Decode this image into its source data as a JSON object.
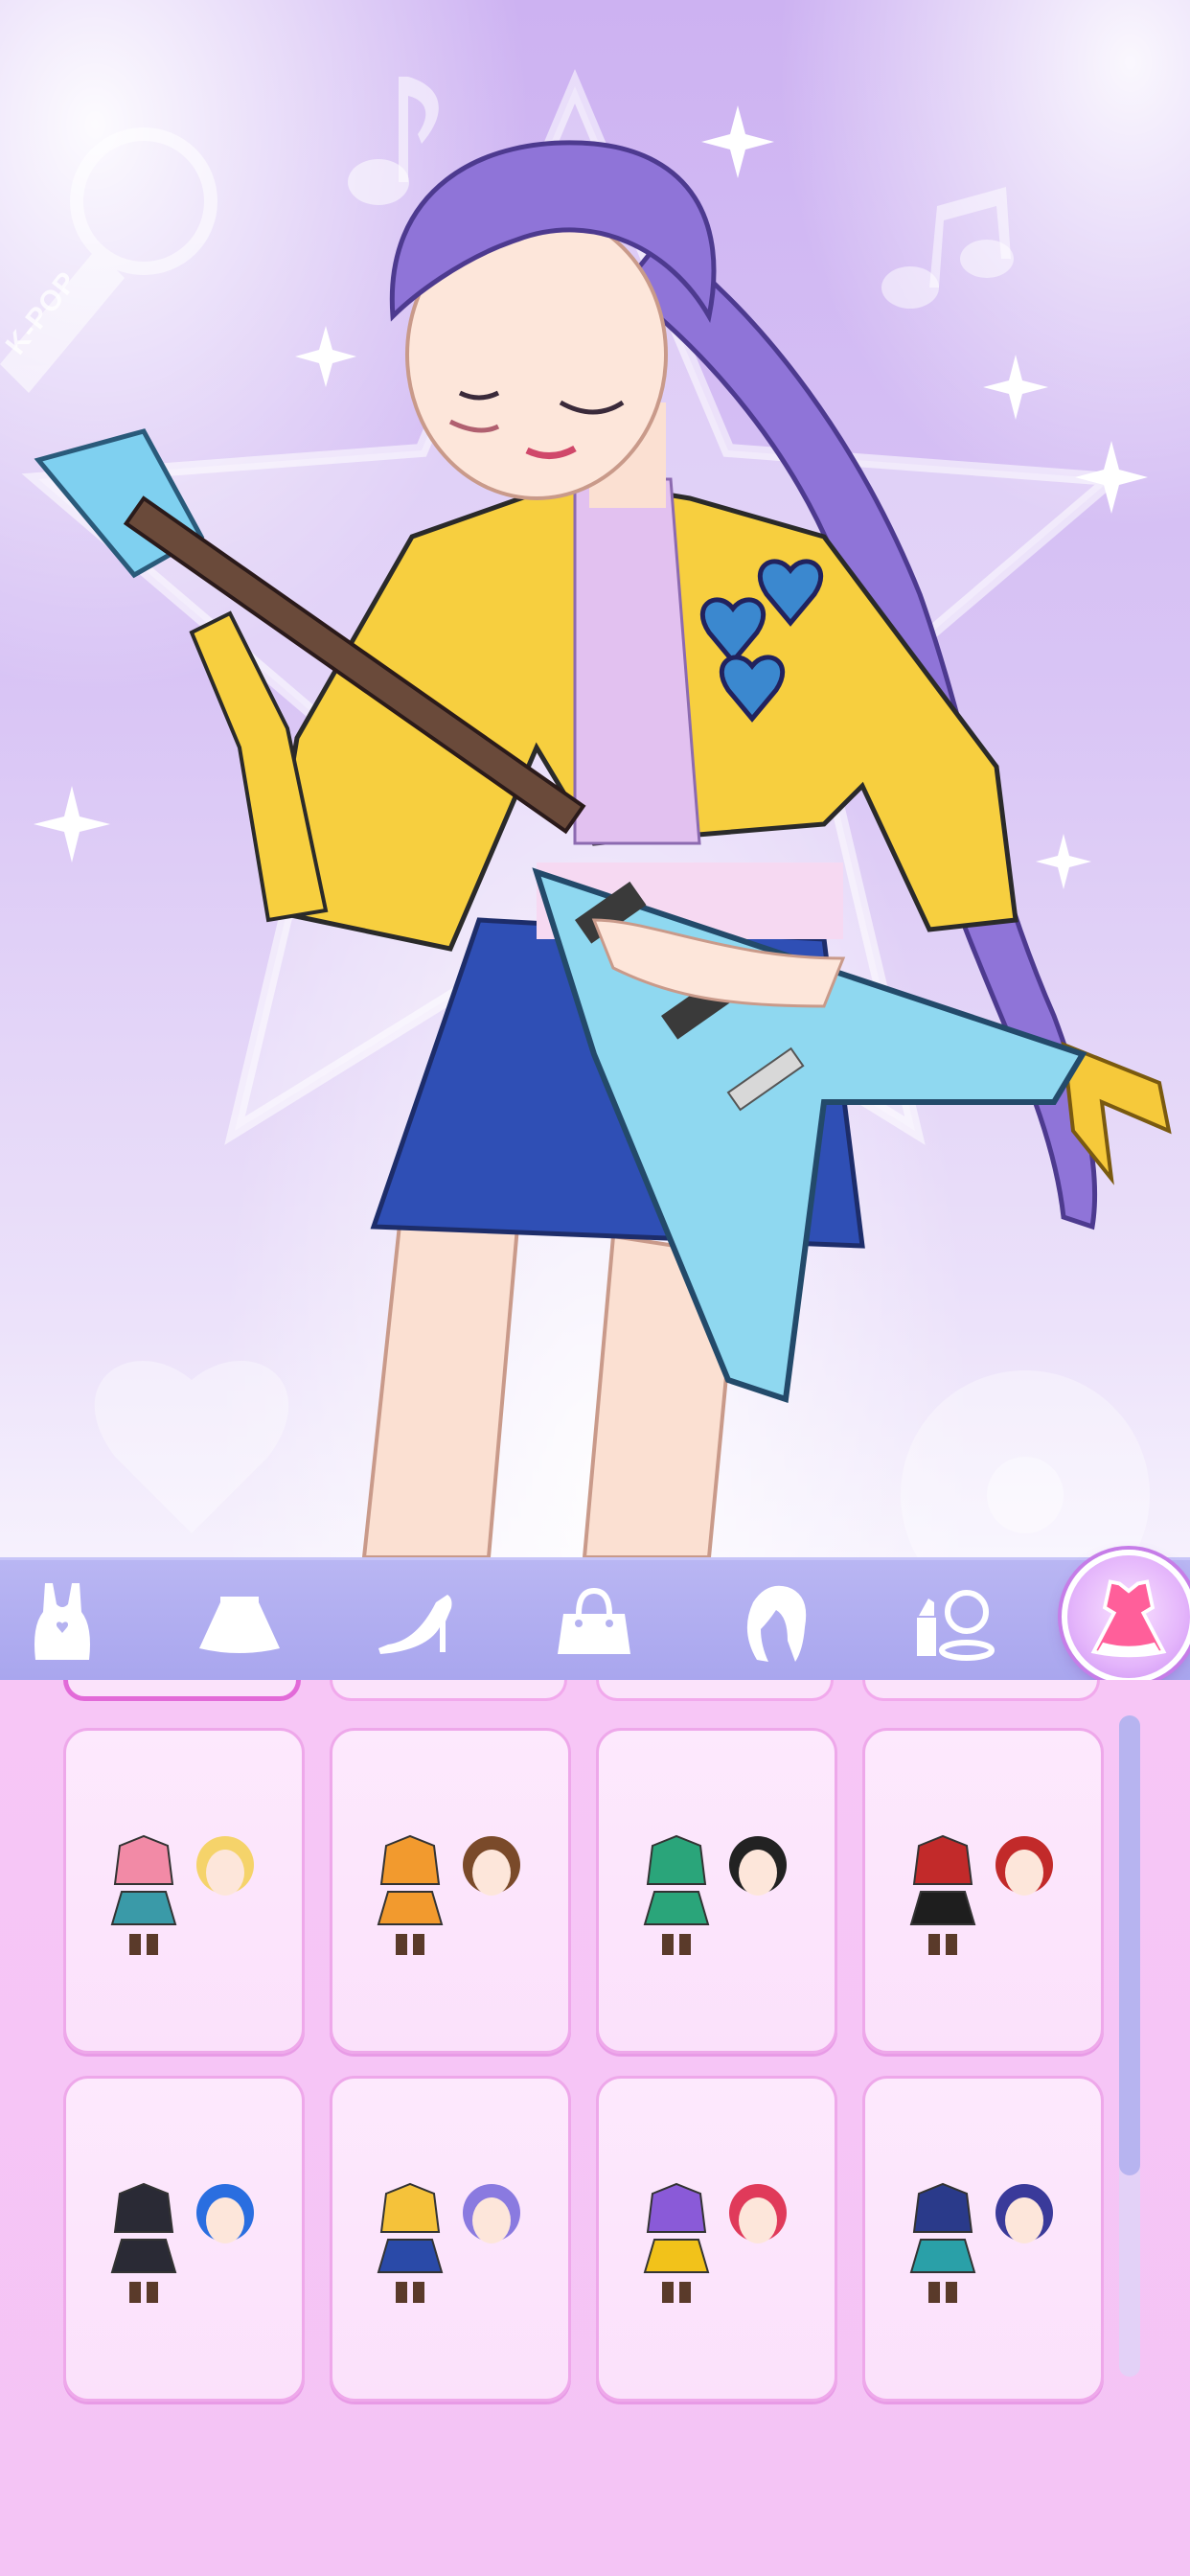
{
  "scene": {
    "badge_text": "K-POP",
    "character": "rockstar-girl-with-flying-v-guitar"
  },
  "tabs": [
    {
      "name": "tops",
      "icon": "tank-top-icon",
      "selected": false
    },
    {
      "name": "skirts",
      "icon": "skirt-icon",
      "selected": false
    },
    {
      "name": "shoes",
      "icon": "high-heel-icon",
      "selected": false
    },
    {
      "name": "bags",
      "icon": "handbag-icon",
      "selected": false
    },
    {
      "name": "hair",
      "icon": "hair-icon",
      "selected": false
    },
    {
      "name": "makeup",
      "icon": "lipstick-mirror-icon",
      "selected": false
    },
    {
      "name": "outfits",
      "icon": "dress-icon",
      "selected": true
    }
  ],
  "outfit_grid": {
    "rows": [
      [
        {
          "item": "outfit-pink-jacket-teal-skirt-blonde",
          "colors": [
            "#f28aa6",
            "#3a9aa8",
            "#f5d36a"
          ]
        },
        {
          "item": "outfit-orange-qipao-brown-hair",
          "colors": [
            "#f29a2e",
            "#f29a2e",
            "#7a4a2a"
          ]
        },
        {
          "item": "outfit-green-tracksuit-skull-tee",
          "colors": [
            "#2aa57a",
            "#2aa57a",
            "#222222"
          ]
        },
        {
          "item": "outfit-red-black-gothic-corset",
          "colors": [
            "#c22a2a",
            "#1e1e1e",
            "#c22a2a"
          ]
        }
      ],
      [
        {
          "item": "outfit-black-crop-cat-ears-blue-hair",
          "colors": [
            "#2a2a35",
            "#2a2a35",
            "#2a6ee0"
          ]
        },
        {
          "item": "outfit-yellow-jacket-denim-purple-hair",
          "colors": [
            "#f5c23a",
            "#2a4aa8",
            "#8a7ae0"
          ]
        },
        {
          "item": "outfit-purple-tee-yellow-skirt-red-hair",
          "colors": [
            "#8a5ad8",
            "#f2c21a",
            "#e03a5a"
          ]
        },
        {
          "item": "outfit-navy-cap-teal-dress",
          "colors": [
            "#2a3a8a",
            "#2aa0a8",
            "#3a3a9a"
          ]
        }
      ]
    ]
  },
  "colors": {
    "tab_bar": "#aaa7ef",
    "panel": "#f5c5f5",
    "card_border": "#eea8ea",
    "selected_ring": "#c67de8"
  }
}
